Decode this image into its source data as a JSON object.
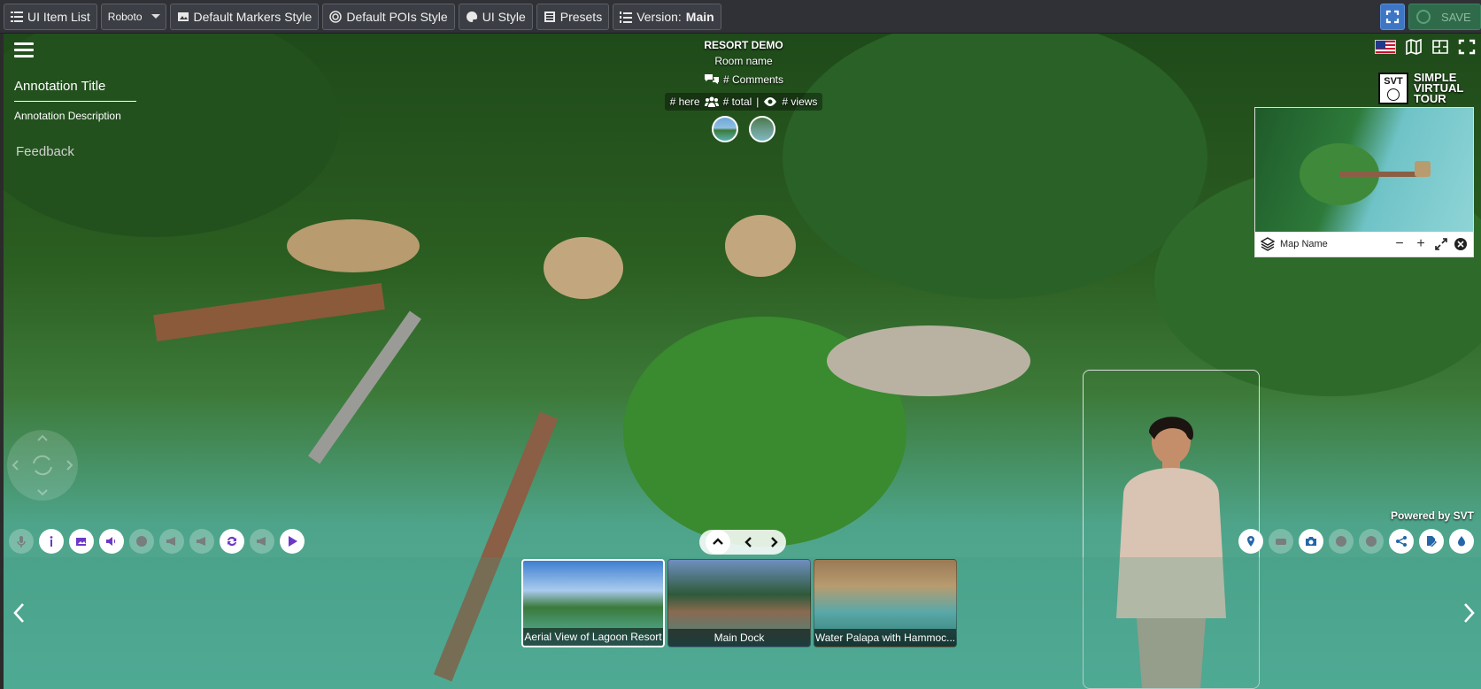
{
  "toolbar": {
    "ui_item_list": "UI Item List",
    "font_select": "Roboto",
    "default_markers_style": "Default Markers Style",
    "default_pois_style": "Default POIs Style",
    "ui_style": "UI Style",
    "presets": "Presets",
    "version_label": "Version:",
    "version_value": "Main",
    "save": "SAVE"
  },
  "annotation": {
    "title": "Annotation Title",
    "description": "Annotation Description"
  },
  "feedback": "Feedback",
  "tour": {
    "name": "RESORT DEMO",
    "room": "Room name",
    "comments": "# Comments",
    "here": "# here",
    "total": "# total",
    "separator": "|",
    "views": "# views"
  },
  "logo": {
    "box_text": "SVT",
    "line1": "SIMPLE",
    "line2": "VIRTUAL",
    "line3": "TOUR"
  },
  "map": {
    "name": "Map Name",
    "zoom_out": "−",
    "zoom_in": "+"
  },
  "powered_by": "Powered by SVT",
  "thumbnails": [
    {
      "label": "Aerial View of Lagoon Resort",
      "active": true
    },
    {
      "label": "Main Dock",
      "active": false
    },
    {
      "label": "Water Palapa with Hammoc...",
      "active": false
    }
  ],
  "colors": {
    "toolbar_bg": "#2f3136",
    "accent_blue": "#3d76c4",
    "save_green": "#2f6b4a",
    "left_icon_purple": "#6b39c8",
    "right_icon_blue": "#2466a8"
  }
}
